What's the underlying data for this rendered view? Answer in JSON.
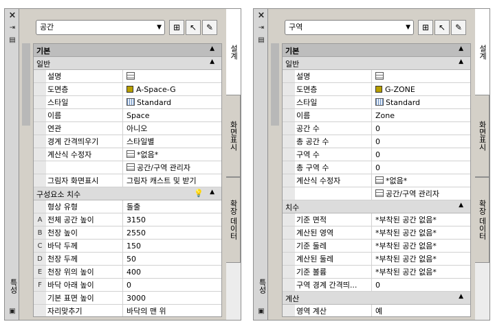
{
  "colors": {
    "layer_swatch": "#b8a000"
  },
  "left": {
    "title": "공간",
    "strip_title": "특성",
    "toolbar": {
      "dropdown": "공간",
      "buttons": [
        "select-objects-icon",
        "quick-select-icon",
        "toggle-pickadd-icon"
      ]
    },
    "tabs": [
      "설계",
      "화면표시",
      "확장 데이터"
    ],
    "sections": [
      {
        "type": "h1",
        "label": "기본",
        "caret": "▲"
      },
      {
        "type": "h2",
        "label": "일반",
        "caret": "▲"
      },
      {
        "name": "설명",
        "value": "",
        "icon": "list"
      },
      {
        "name": "도면층",
        "value": "A-Space-G",
        "icon": "swatch"
      },
      {
        "name": "스타일",
        "value": "Standard",
        "icon": "grid"
      },
      {
        "name": "이름",
        "value": "Space"
      },
      {
        "name": "연관",
        "value": "아니오"
      },
      {
        "name": "경계 간격띄우기",
        "value": "스타일별"
      },
      {
        "name": "계산식 수정자",
        "value": "*없음*",
        "icon": "list"
      },
      {
        "name": "",
        "value": "공간/구역 관리자",
        "icon": "list"
      },
      {
        "name": "그림자 화면표시",
        "value": "그림자 캐스트 및 받기"
      },
      {
        "type": "h2",
        "label": "구성요소 치수",
        "caret": "▲",
        "extra": "💡"
      },
      {
        "name": "형상 유형",
        "value": "돌출"
      },
      {
        "key": "A",
        "name": "전체 공간 높이",
        "value": "3150"
      },
      {
        "key": "B",
        "name": "천장 높이",
        "value": "2550"
      },
      {
        "key": "C",
        "name": "바닥 두께",
        "value": "150"
      },
      {
        "key": "D",
        "name": "천장 두께",
        "value": "50"
      },
      {
        "key": "E",
        "name": "천장 위의 높이",
        "value": "400"
      },
      {
        "key": "F",
        "name": "바닥 아래 높이",
        "value": "0"
      },
      {
        "name": "기본 표면 높이",
        "value": "3000"
      },
      {
        "name": "자리맞추기",
        "value": "바닥의 맨 위"
      }
    ]
  },
  "right": {
    "title": "구역",
    "strip_title": "특성",
    "toolbar": {
      "dropdown": "구역",
      "buttons": [
        "select-objects-icon",
        "quick-select-icon",
        "toggle-pickadd-icon"
      ]
    },
    "tabs": [
      "설계",
      "화면표시",
      "확장 데이터"
    ],
    "sections": [
      {
        "type": "h1",
        "label": "기본",
        "caret": "▲"
      },
      {
        "type": "h2",
        "label": "일반",
        "caret": "▲"
      },
      {
        "name": "설명",
        "value": "",
        "icon": "list"
      },
      {
        "name": "도면층",
        "value": "G-ZONE",
        "icon": "swatch"
      },
      {
        "name": "스타일",
        "value": "Standard",
        "icon": "grid"
      },
      {
        "name": "이름",
        "value": "Zone"
      },
      {
        "name": "공간 수",
        "value": "0"
      },
      {
        "name": "총 공간 수",
        "value": "0"
      },
      {
        "name": "구역 수",
        "value": "0"
      },
      {
        "name": "총 구역 수",
        "value": "0"
      },
      {
        "name": "계산식 수정자",
        "value": "*없음*",
        "icon": "list"
      },
      {
        "name": "",
        "value": "공간/구역 관리자",
        "icon": "list"
      },
      {
        "type": "h2",
        "label": "치수",
        "caret": "▲"
      },
      {
        "name": "기준 면적",
        "value": "*부착된 공간 없음*"
      },
      {
        "name": "계산된 영역",
        "value": "*부착된 공간 없음*"
      },
      {
        "name": "기준 둘레",
        "value": "*부착된 공간 없음*"
      },
      {
        "name": "계산된 둘레",
        "value": "*부착된 공간 없음*"
      },
      {
        "name": "기준 볼륨",
        "value": "*부착된 공간 없음*"
      },
      {
        "name": "구역 경계 간격띄...",
        "value": "0"
      },
      {
        "type": "h2",
        "label": "계산",
        "caret": "▲"
      },
      {
        "name": "영역 계산",
        "value": "예"
      }
    ]
  }
}
